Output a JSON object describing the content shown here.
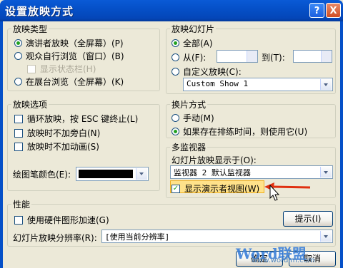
{
  "window": {
    "title": "设置放映方式",
    "help_glyph": "?",
    "close_glyph": "X"
  },
  "show_type": {
    "legend": "放映类型",
    "presenter": "演讲者放映（全屏幕）(P)",
    "individual": "观众自行浏览（窗口）(B)",
    "show_scrollbar": "显示状态栏(H)",
    "kiosk": "在展台浏览（全屏幕）(K)",
    "selected": "presenter"
  },
  "show_slides": {
    "legend": "放映幻灯片",
    "all": "全部(A)",
    "from": "从(F):",
    "to": "到(T):",
    "custom": "自定义放映(C):",
    "custom_value": "Custom Show 1",
    "selected": "all"
  },
  "show_options": {
    "legend": "放映选项",
    "loop": "循环放映，按 ESC 键终止(L)",
    "no_narration": "放映时不加旁白(N)",
    "no_animation": "放映时不加动画(S)",
    "pen_color_label": "绘图笔颜色(E):",
    "pen_color": "#000000"
  },
  "advance": {
    "legend": "换片方式",
    "manual": "手动(M)",
    "timings": "如果存在排练时间，则使用它(U)",
    "selected": "timings"
  },
  "multi_monitor": {
    "legend": "多监视器",
    "display_on_label": "幻灯片放映显示于(O):",
    "monitor_value": "监视器 2  默认监视器",
    "presenter_view": "显示演示者视图(W)",
    "presenter_view_checked": true
  },
  "performance": {
    "legend": "性能",
    "hw_accel": "使用硬件图形加速(G)",
    "tips_button": "提示(I)",
    "resolution_label": "幻灯片放映分辨率(R):",
    "resolution_value": "[使用当前分辨率]"
  },
  "footer": {
    "ok": "确定",
    "cancel": "取消"
  },
  "watermark": {
    "brand": "Word联盟",
    "url": "www.wordlm.com"
  },
  "colors": {
    "title_bar": "#0550c8",
    "dialog_bg": "#ece9d8",
    "highlight": "#ffe28a",
    "arrow": "#e03010"
  }
}
